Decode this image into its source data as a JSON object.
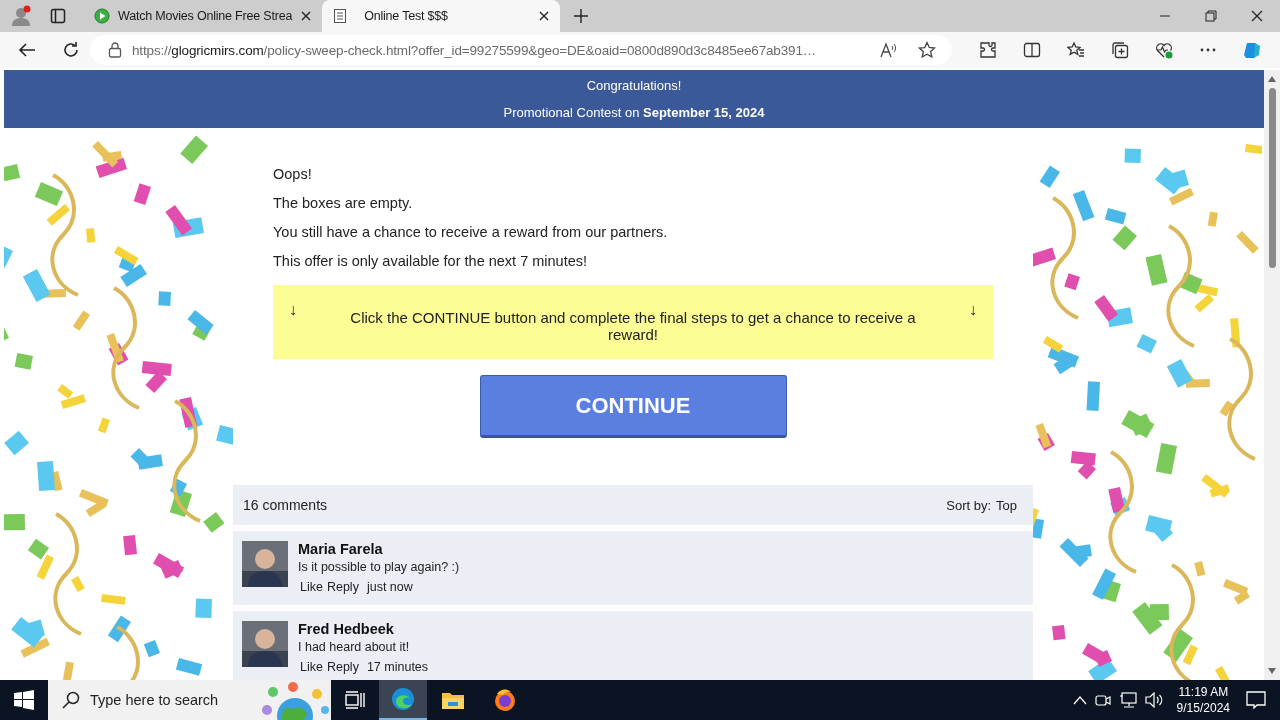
{
  "browser": {
    "tabs": [
      {
        "title": "Watch Movies Online Free Strea",
        "selected": false,
        "kind": "play"
      },
      {
        "title": "Online Test $$$",
        "selected": true,
        "kind": "page"
      }
    ],
    "url_scheme": "https://",
    "url_domain": "glogricmirs.com",
    "url_path": "/policy-sweep-check.html?offer_id=99275599&geo=DE&oaid=0800d890d3c8485ee67ab391…"
  },
  "header": {
    "title": "Congratulations!",
    "subtitle": "Promotional Contest on **September 15, 2024**"
  },
  "messages": [
    "Oops!",
    "The boxes are empty.",
    "You still have a chance to receive a reward from our partners.",
    "This offer is only available for the next 7 minutes!"
  ],
  "notice": {
    "left_arrow": "↓",
    "text": "Click the CONTINUE button and complete the final steps to get a chance to receive a reward!",
    "right_arrow": "↓"
  },
  "continue_button": "CONTINUE",
  "comments": {
    "count": "16 comments",
    "sort_label": "Sort by:",
    "sort_value": "Top",
    "items": [
      {
        "name": "Maria Farela",
        "text": "Is it possible to play again? :)",
        "like": "Like",
        "reply": "Reply",
        "time": "just now"
      },
      {
        "name": "Fred Hedbeek",
        "text": "I had heard about it!",
        "like": "Like",
        "reply": "Reply",
        "time": "17 minutes"
      }
    ]
  },
  "taskbar": {
    "search_placeholder": "Type here to search",
    "time": "11:19 AM",
    "date": "9/15/2024"
  }
}
